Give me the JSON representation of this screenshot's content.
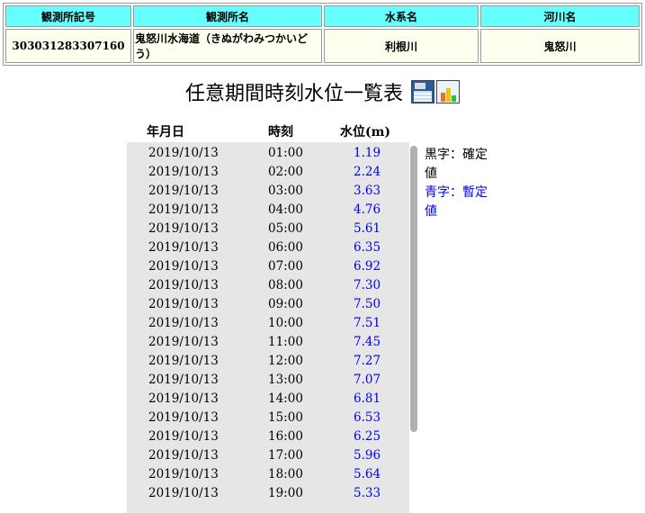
{
  "station": {
    "headers": [
      "観測所記号",
      "観測所名",
      "水系名",
      "河川名"
    ],
    "code": "303031283307160",
    "name": "鬼怒川水海道（きぬがわみつかいどう）",
    "system": "利根川",
    "river": "鬼怒川"
  },
  "title": "任意期間時刻水位一覧表",
  "icons": [
    "save-disk-icon",
    "graph-icon"
  ],
  "columns": {
    "date": "年月日",
    "time": "時刻",
    "level": "水位(m)"
  },
  "rows": [
    {
      "date": "2019/10/13",
      "time": "01:00",
      "level": "1.19"
    },
    {
      "date": "2019/10/13",
      "time": "02:00",
      "level": "2.24"
    },
    {
      "date": "2019/10/13",
      "time": "03:00",
      "level": "3.63"
    },
    {
      "date": "2019/10/13",
      "time": "04:00",
      "level": "4.76"
    },
    {
      "date": "2019/10/13",
      "time": "05:00",
      "level": "5.61"
    },
    {
      "date": "2019/10/13",
      "time": "06:00",
      "level": "6.35"
    },
    {
      "date": "2019/10/13",
      "time": "07:00",
      "level": "6.92"
    },
    {
      "date": "2019/10/13",
      "time": "08:00",
      "level": "7.30"
    },
    {
      "date": "2019/10/13",
      "time": "09:00",
      "level": "7.50"
    },
    {
      "date": "2019/10/13",
      "time": "10:00",
      "level": "7.51"
    },
    {
      "date": "2019/10/13",
      "time": "11:00",
      "level": "7.45"
    },
    {
      "date": "2019/10/13",
      "time": "12:00",
      "level": "7.27"
    },
    {
      "date": "2019/10/13",
      "time": "13:00",
      "level": "7.07"
    },
    {
      "date": "2019/10/13",
      "time": "14:00",
      "level": "6.81"
    },
    {
      "date": "2019/10/13",
      "time": "15:00",
      "level": "6.53"
    },
    {
      "date": "2019/10/13",
      "time": "16:00",
      "level": "6.25"
    },
    {
      "date": "2019/10/13",
      "time": "17:00",
      "level": "5.96"
    },
    {
      "date": "2019/10/13",
      "time": "18:00",
      "level": "5.64"
    },
    {
      "date": "2019/10/13",
      "time": "19:00",
      "level": "5.33"
    }
  ],
  "legend": {
    "black": "黒字：確定値",
    "blue": "青字：暫定値"
  },
  "colors": {
    "header_bg": "#66ffff",
    "provisional": "#0000ee"
  }
}
